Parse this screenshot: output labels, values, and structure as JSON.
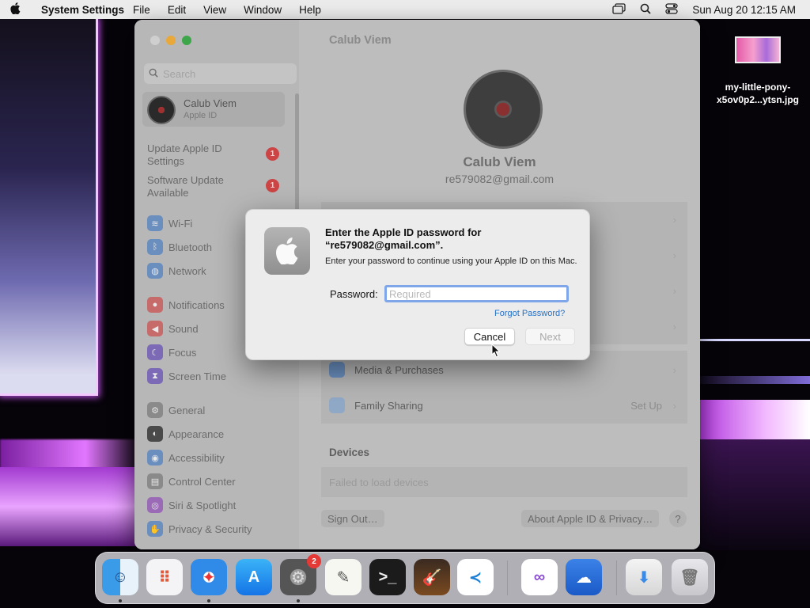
{
  "menubar": {
    "app_name": "System Settings",
    "menus": [
      "File",
      "Edit",
      "View",
      "Window",
      "Help"
    ],
    "clock": "Sun Aug 20  12:15 AM"
  },
  "window": {
    "title": "Calub Viem",
    "search_placeholder": "Search",
    "account": {
      "name": "Calub Viem",
      "subtitle": "Apple ID"
    },
    "alerts": [
      {
        "label": "Update Apple ID Settings",
        "badge": "1"
      },
      {
        "label": "Software Update Available",
        "badge": "1"
      }
    ],
    "sidebar_groups": [
      [
        {
          "label": "Wi-Fi",
          "icon": "wifi-icon",
          "color": "#6a8fbf"
        },
        {
          "label": "Bluetooth",
          "icon": "bluetooth-icon",
          "color": "#6a8fbf"
        },
        {
          "label": "Network",
          "icon": "globe-icon",
          "color": "#6a8fbf"
        }
      ],
      [
        {
          "label": "Notifications",
          "icon": "bell-icon",
          "color": "#c66a6a"
        },
        {
          "label": "Sound",
          "icon": "speaker-icon",
          "color": "#c66a6a"
        },
        {
          "label": "Focus",
          "icon": "moon-icon",
          "color": "#7d6ab6"
        },
        {
          "label": "Screen Time",
          "icon": "hourglass-icon",
          "color": "#7d6ab6"
        }
      ],
      [
        {
          "label": "General",
          "icon": "gear-icon",
          "color": "#8a8a8a"
        },
        {
          "label": "Appearance",
          "icon": "appearance-icon",
          "color": "#4a4a4a"
        },
        {
          "label": "Accessibility",
          "icon": "accessibility-icon",
          "color": "#6a8fbf"
        },
        {
          "label": "Control Center",
          "icon": "control-center-icon",
          "color": "#8a8a8a"
        },
        {
          "label": "Siri & Spotlight",
          "icon": "siri-icon",
          "color": "#9b6ab6"
        },
        {
          "label": "Privacy & Security",
          "icon": "hand-icon",
          "color": "#6a8fbf"
        }
      ]
    ],
    "profile": {
      "name": "Calub Viem",
      "email": "re579082@gmail.com"
    },
    "rows": [
      {
        "label": "Media & Purchases",
        "value": "",
        "icon": "app-store-icon",
        "color": "#6a8fbf"
      },
      {
        "label": "Family Sharing",
        "value": "Set Up",
        "icon": "family-icon",
        "color": "#8fa8c6"
      }
    ],
    "devices_heading": "Devices",
    "devices_message": "Failed to load devices",
    "sign_out": "Sign Out…",
    "about": "About Apple ID & Privacy…",
    "help": "?"
  },
  "dialog": {
    "title": "Enter the Apple ID password for “re579082@gmail.com”.",
    "message": "Enter your password to continue using your Apple ID on this Mac.",
    "password_label": "Password:",
    "password_placeholder": "Required",
    "forgot": "Forgot Password?",
    "cancel": "Cancel",
    "next": "Next"
  },
  "desktop_file": {
    "name": "my-little-pony-x5ov0p2...ytsn.jpg"
  },
  "dock": {
    "apps": [
      {
        "name": "Finder",
        "icon": "finder-icon",
        "running": true
      },
      {
        "name": "Launchpad",
        "icon": "launchpad-icon",
        "running": false
      },
      {
        "name": "Safari",
        "icon": "safari-icon",
        "running": true
      },
      {
        "name": "App Store",
        "icon": "app-store-icon",
        "running": false
      },
      {
        "name": "System Settings",
        "icon": "system-settings-icon",
        "running": true,
        "badge": "2"
      },
      {
        "name": "TextEdit",
        "icon": "textedit-icon",
        "running": false
      },
      {
        "name": "Terminal",
        "icon": "terminal-icon",
        "running": false
      },
      {
        "name": "GarageBand",
        "icon": "garageband-icon",
        "running": false
      },
      {
        "name": "Visual Studio Code",
        "icon": "vscode-icon",
        "running": false
      },
      {
        "name": "Visual Studio",
        "icon": "visual-studio-icon",
        "running": false
      },
      {
        "name": "Weather",
        "icon": "weather-icon",
        "running": false
      },
      {
        "name": "Downloads",
        "icon": "downloads-folder-icon",
        "running": false
      },
      {
        "name": "Trash",
        "icon": "trash-icon",
        "running": false
      }
    ]
  }
}
